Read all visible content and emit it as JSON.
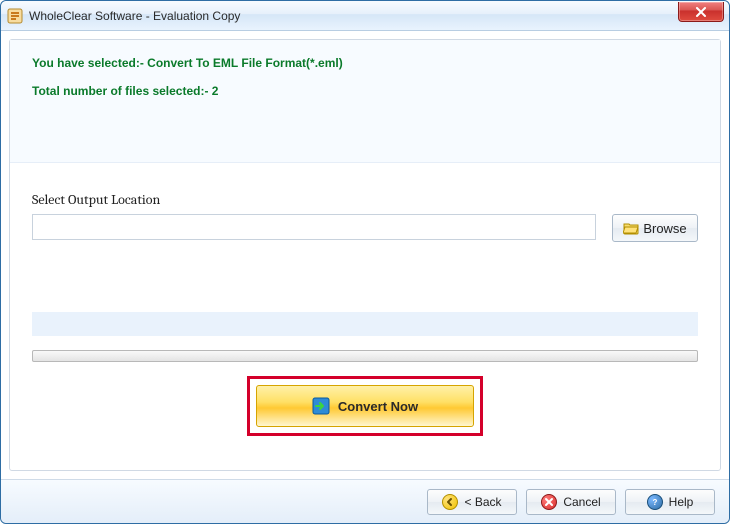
{
  "window": {
    "title": "WholeClear Software - Evaluation Copy"
  },
  "info": {
    "selected_line": "You have selected:- Convert To EML File Format(*.eml)",
    "count_line": "Total number of files selected:- 2"
  },
  "output": {
    "label": "Select Output Location",
    "path_value": "",
    "browse_label": "Browse"
  },
  "actions": {
    "convert_label": "Convert Now"
  },
  "footer": {
    "back_label": "< Back",
    "cancel_label": "Cancel",
    "help_label": "Help"
  }
}
